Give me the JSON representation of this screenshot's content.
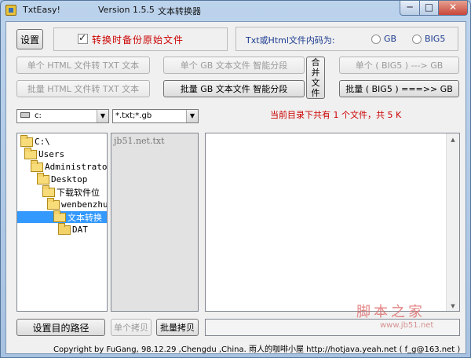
{
  "window": {
    "app_name": "TxtEasy!",
    "version": "Version 1.5.5",
    "subtitle": "文本转换器",
    "controls": {
      "minimize": "─",
      "maximize": "□",
      "close": "✕"
    }
  },
  "toolbar": {
    "settings_label": "设置",
    "backup_label": "转换时备份原始文件",
    "backup_checked": true,
    "encoding_label": "Txt或Html文件内码为:",
    "encoding_options": [
      "GB",
      "BIG5"
    ],
    "encoding_selected": "none"
  },
  "actions": {
    "single_html_to_txt": "单个 HTML 文件转 TXT 文本",
    "single_gb_split": "单个 GB 文本文件 智能分段",
    "merge_files": "合并文件",
    "single_big5_to_gb": "单个 ( BIG5 ) ---> GB",
    "batch_html_to_txt": "批量 HTML 文件转 TXT 文本",
    "batch_gb_split": "批量 GB 文本文件 智能分段",
    "batch_big5_to_gb": "批量 ( BIG5 ) ===>> GB"
  },
  "browser": {
    "drive_value": "c:",
    "filter_value": "*.txt;*.gb",
    "status_text": "当前目录下共有 1 个文件，共 5 K",
    "tree": [
      {
        "label": "C:\\",
        "level": 0
      },
      {
        "label": "Users",
        "level": 1
      },
      {
        "label": "Administrator",
        "level": 2
      },
      {
        "label": "Desktop",
        "level": 3
      },
      {
        "label": "下载软件位",
        "level": 4
      },
      {
        "label": "wenbenzhu",
        "level": 5
      },
      {
        "label": "文本转换",
        "level": 6,
        "selected": true
      },
      {
        "label": "DAT",
        "level": 7
      }
    ],
    "files": [
      "jb51.net.txt"
    ]
  },
  "bottom": {
    "set_dest_label": "设置目的路径",
    "single_copy_label": "单个拷贝",
    "batch_copy_label": "批量拷贝",
    "dest_path_value": ""
  },
  "footer": {
    "copyright": "Copyright by FuGang, 98.12.29 ,Chengdu ,China. 雨人的咖啡小屋 http://hotjava.yeah.net ( f_g@163.net )"
  },
  "watermark": {
    "text": "脚本之家",
    "url": "www.jb51.net"
  },
  "colors": {
    "accent_red": "#cc0000",
    "accent_blue": "#1a3a8f",
    "selection": "#3399ff"
  }
}
